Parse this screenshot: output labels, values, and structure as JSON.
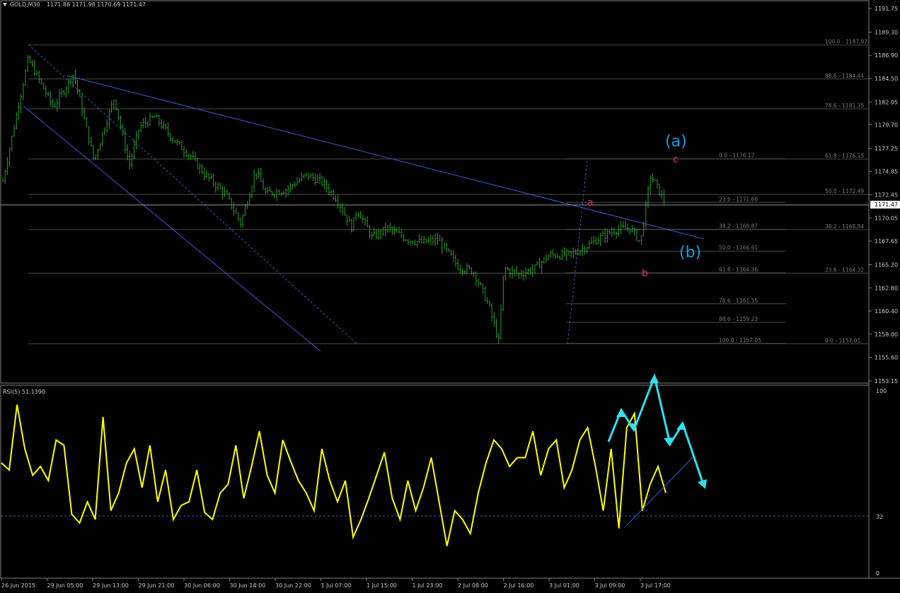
{
  "window": {
    "symbol_header": "GOLD,M30",
    "ohlc": "1171.86 1171.98 1170.69 1171.47",
    "current_price_label": "1171.47"
  },
  "main_price_axis": {
    "ticks": [
      "1191.75",
      "1189.30",
      "1186.90",
      "1184.50",
      "1182.05",
      "1179.70",
      "1177.25",
      "1174.85",
      "1172.45",
      "1170.05",
      "1167.65",
      "1165.20",
      "1162.80",
      "1160.40",
      "1158.00",
      "1155.60",
      "1153.15"
    ]
  },
  "time_axis": {
    "labels": [
      "26 Jun 2015",
      "29 Jun 05:00",
      "29 Jun 13:00",
      "29 Jun 21:00",
      "30 Jun 06:00",
      "30 Jun 14:00",
      "30 Jun 22:00",
      "1 Jul 07:00",
      "1 Jul 15:00",
      "1 Jul 23:00",
      "2 Jul 08:00",
      "2 Jul 16:00",
      "3 Jul 01:00",
      "3 Jul 09:00",
      "3 Jul 17:00"
    ]
  },
  "fibonacci_left": [
    {
      "label": "100.0 - 1187.97",
      "price": 1187.97
    },
    {
      "label": "88.6 - 1184.44",
      "price": 1184.44
    },
    {
      "label": "78.6 - 1181.35",
      "price": 1181.35
    },
    {
      "label": "61.8 - 1176.15",
      "price": 1176.15
    },
    {
      "label": "50.0 - 1172.49",
      "price": 1172.49
    },
    {
      "label": "38.2 - 1168.84",
      "price": 1168.84
    },
    {
      "label": "23.6 - 1164.32",
      "price": 1164.32
    },
    {
      "label": "0.0 - 1157.01",
      "price": 1157.01
    }
  ],
  "fibonacci_right": [
    {
      "label": "0.0 - 1176.17",
      "price": 1176.17
    },
    {
      "label": "23.6 - 1171.66",
      "price": 1171.66
    },
    {
      "label": "38.2 - 1168.87",
      "price": 1168.87
    },
    {
      "label": "50.0 - 1166.61",
      "price": 1166.61
    },
    {
      "label": "61.8 - 1164.36",
      "price": 1164.36
    },
    {
      "label": "78.6 - 1161.15",
      "price": 1161.15
    },
    {
      "label": "88.6 - 1159.23",
      "price": 1159.23
    },
    {
      "label": "100.0 - 1157.05",
      "price": 1157.05
    }
  ],
  "annotations": {
    "wave_a_big": "(a)",
    "wave_b_big": "(b)",
    "small_a": "a",
    "small_b": "b",
    "small_c": "c"
  },
  "rsi_panel": {
    "header": "RSI(5) 51.1390",
    "ticks": [
      "100",
      "32",
      "0"
    ],
    "level": 32
  },
  "colors": {
    "background": "#000000",
    "candles": "#2e9e2e",
    "trendline": "#3a5ad0",
    "fib": "#4a4a4a",
    "rsi": "#ffff00",
    "annotation_cyan": "#1e9bdc",
    "annotation_pink": "#e0307a",
    "arrow": "#2fe0f0",
    "text": "#c8c8c8"
  },
  "chart_data": {
    "type": "line",
    "title": "",
    "price_range": [
      1153.15,
      1191.75
    ],
    "rsi_range": [
      0,
      100
    ],
    "close_path": [
      [
        0,
        1173.9
      ],
      [
        5,
        1186.5
      ],
      [
        10,
        1181.5
      ],
      [
        14,
        1185.0
      ],
      [
        18,
        1176.0
      ],
      [
        22,
        1182.5
      ],
      [
        25,
        1175.5
      ],
      [
        27,
        1179.5
      ],
      [
        30,
        1180.5
      ],
      [
        34,
        1178.0
      ],
      [
        37,
        1176.5
      ],
      [
        40,
        1174.5
      ],
      [
        44,
        1172.5
      ],
      [
        47,
        1169.5
      ],
      [
        50,
        1175.0
      ],
      [
        52,
        1172.5
      ],
      [
        56,
        1173.0
      ],
      [
        60,
        1174.5
      ],
      [
        63,
        1173.8
      ],
      [
        66,
        1172.0
      ],
      [
        69,
        1169.0
      ],
      [
        70,
        1171.0
      ],
      [
        73,
        1168.0
      ],
      [
        76,
        1169.0
      ],
      [
        80,
        1167.8
      ],
      [
        83,
        1167.5
      ],
      [
        86,
        1167.8
      ],
      [
        90,
        1165.0
      ],
      [
        93,
        1164.5
      ],
      [
        96,
        1161.0
      ],
      [
        98,
        1157.2
      ],
      [
        99,
        1164.8
      ],
      [
        102,
        1164.2
      ],
      [
        105,
        1164.8
      ],
      [
        108,
        1166.2
      ],
      [
        112,
        1166.2
      ],
      [
        115,
        1167.0
      ],
      [
        118,
        1168.0
      ],
      [
        121,
        1168.8
      ],
      [
        124,
        1169.0
      ],
      [
        126,
        1167.5
      ],
      [
        128,
        1174.5
      ],
      [
        131,
        1171.47
      ]
    ],
    "rsi_values": [
      62,
      58,
      95,
      70,
      55,
      60,
      52,
      75,
      72,
      33,
      28,
      40,
      30,
      88,
      35,
      45,
      62,
      70,
      48,
      72,
      40,
      58,
      30,
      38,
      40,
      58,
      34,
      30,
      45,
      50,
      72,
      42,
      60,
      80,
      55,
      45,
      75,
      63,
      52,
      45,
      35,
      70,
      52,
      40,
      52,
      20,
      30,
      42,
      55,
      68,
      42,
      30,
      52,
      35,
      48,
      65,
      40,
      15,
      35,
      30,
      22,
      45,
      62,
      75,
      70,
      60,
      65,
      65,
      80,
      55,
      70,
      75,
      48,
      58,
      75,
      82,
      60,
      35,
      70,
      25,
      82,
      90,
      35,
      50,
      60,
      45
    ]
  }
}
